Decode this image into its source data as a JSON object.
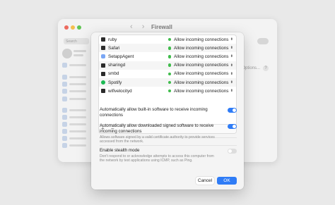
{
  "window": {
    "title": "Firewall",
    "nav_back": "‹",
    "nav_forward": "›",
    "search_placeholder": "Search",
    "options_label": "Options...",
    "help_label": "?"
  },
  "apps": [
    {
      "name": "ruby",
      "connection": "Allow incoming connections",
      "icon": "terminal-icon"
    },
    {
      "name": "Safari",
      "connection": "Allow incoming connections",
      "icon": "terminal-icon"
    },
    {
      "name": "SetappAgent",
      "connection": "Allow incoming connections",
      "icon": "setapp-icon"
    },
    {
      "name": "sharingd",
      "connection": "Allow incoming connections",
      "icon": "terminal-icon"
    },
    {
      "name": "smbd",
      "connection": "Allow incoming connections",
      "icon": "terminal-icon"
    },
    {
      "name": "Spotify",
      "connection": "Allow incoming connections",
      "icon": "spotify-icon"
    },
    {
      "name": "wifivelocityd",
      "connection": "Allow incoming connections",
      "icon": "terminal-icon"
    }
  ],
  "list_controls": {
    "add": "+",
    "remove": "−"
  },
  "settings": {
    "builtin": {
      "title": "Automatically allow built-in software to receive incoming connections",
      "enabled": true
    },
    "signed": {
      "title": "Automatically allow downloaded signed software to receive incoming connections",
      "description": "Allows software signed by a valid certificate authority to provide services accessed from the network.",
      "enabled": true
    },
    "stealth": {
      "title": "Enable stealth mode",
      "description": "Don't respond to or acknowledge attempts to access this computer from the network by test applications using ICMP, such as Ping.",
      "enabled": false
    }
  },
  "buttons": {
    "cancel": "Cancel",
    "ok": "OK"
  },
  "colors": {
    "accent": "#2f7cf6",
    "status_green": "#3fbc4b"
  }
}
